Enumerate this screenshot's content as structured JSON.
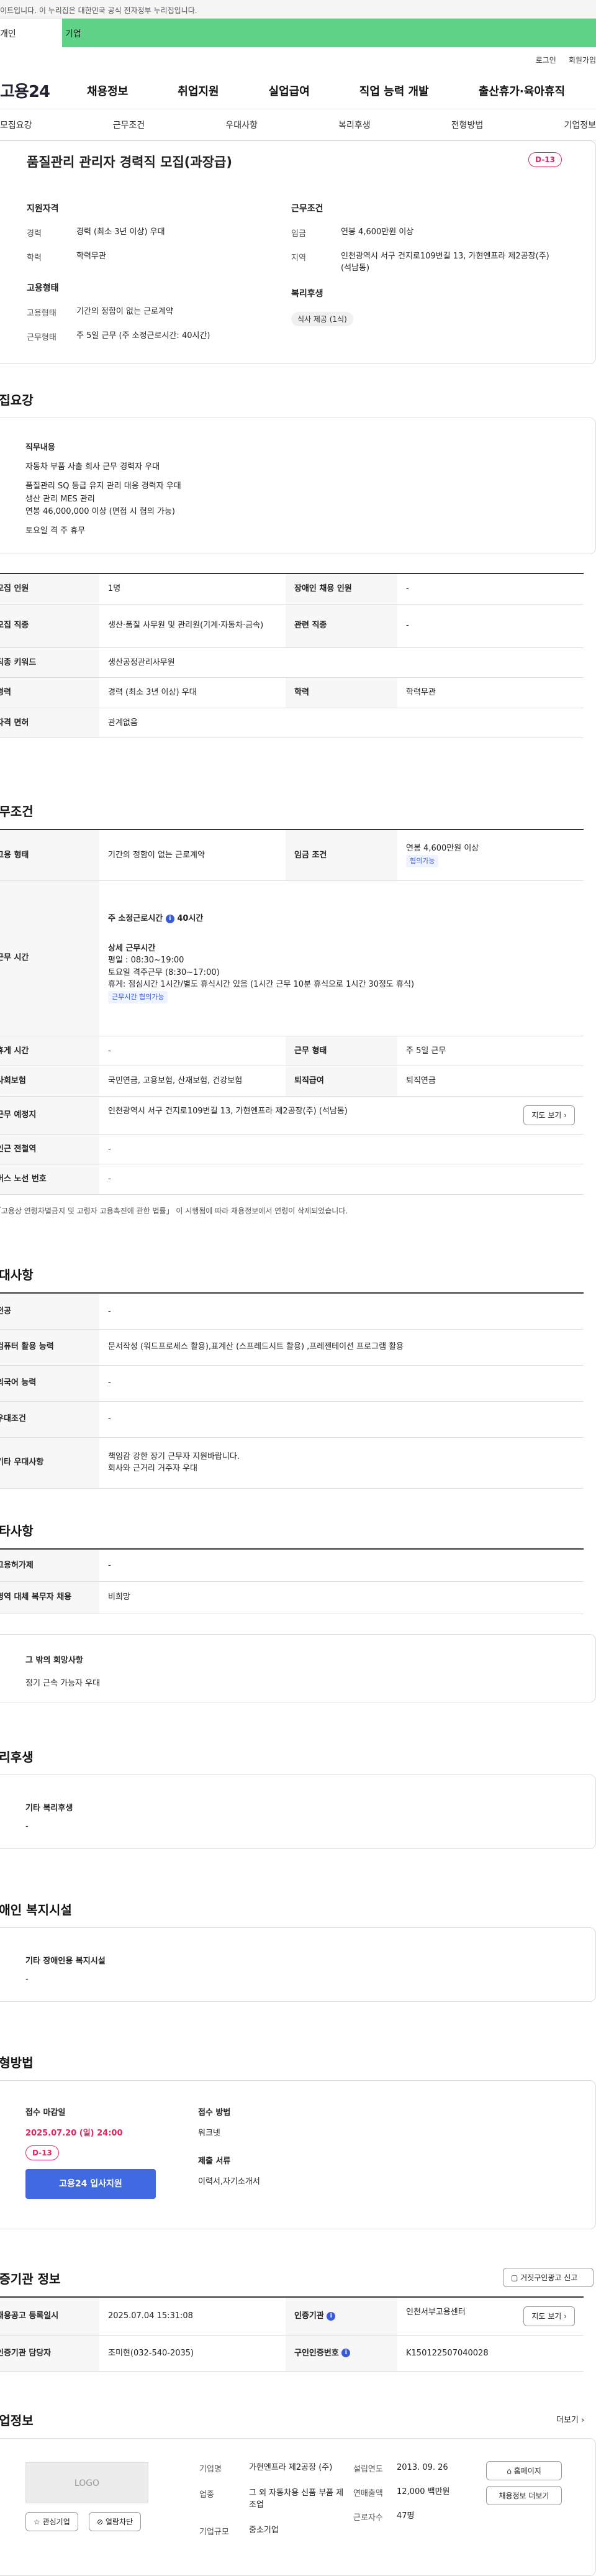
{
  "gov_banner": "이트입니다. 이 누리집은 대한민국 공식 전자정부 누리집입니다.",
  "top_tabs": [
    "개인",
    "기업"
  ],
  "util_links": [
    "로그인",
    "회원가입"
  ],
  "logo": "고용24",
  "gnb": [
    "채용정보",
    "취업지원",
    "실업급여",
    "직업 능력 개발",
    "출산휴가·육아휴직"
  ],
  "anchor_tabs": [
    "모집요강",
    "근무조건",
    "우대사항",
    "복리후생",
    "전형방법",
    "기업정보"
  ],
  "summary": {
    "title": "품질관리 관리자 경력직 모집(과장급)",
    "dday": "D-13",
    "left_title": "지원자격",
    "left_rows": [
      [
        "경력",
        "경력 (최소 3년 이상) 우대"
      ],
      [
        "학력",
        "학력무관"
      ]
    ],
    "right_title": "근무조건",
    "right_rows": [
      [
        "임금",
        "연봉 4,600만원 이상"
      ],
      [
        "지역",
        "인천광역시 서구 건지로109번길 13, 가현엔프라 제2공장(주) (석남동)"
      ]
    ],
    "left2_title": "고용형태",
    "left2_rows": [
      [
        "고용형태",
        "기간의 정함이 없는 근로계약"
      ],
      [
        "근무형태",
        "주 5일 근무 (주 소정근로시간: 40시간)"
      ]
    ],
    "right2_title": "복리후생",
    "right2_chip": "식사 제공 (1식)"
  },
  "recruit": {
    "title": "모집요강",
    "duty_title": "직무내용",
    "duty_lines": [
      "자동차 부품 사출 회사  근무 경력자 우대",
      "",
      "품질관리 SQ 등급 유지 관리 대응 경력자 우대",
      "생산 관리 MES 관리",
      "연봉 46,000,000 이상 (면접 시 협의 가능)",
      "",
      "토요일 격 주 휴무"
    ],
    "rows": [
      [
        "모집 인원",
        "1명",
        "장애인 채용 인원",
        "-"
      ],
      [
        "모집 직종",
        "생산·품질 사무원 및 관리원(기계·자동차·금속)",
        "관련 직종",
        "-"
      ],
      [
        "직종 키워드",
        "생산공정관리사무원",
        "",
        ""
      ],
      [
        "경력",
        "경력 (최소 3년 이상) 우대",
        "학력",
        "학력무관"
      ],
      [
        "자격 면허",
        "관계없음",
        "",
        ""
      ]
    ]
  },
  "work": {
    "title": "근무조건",
    "employ_label": "고용 형태",
    "employ_value": "기간의 정함이 없는 근로계약",
    "wage_label": "임금 조건",
    "wage_value": "연봉 4,600만원 이상",
    "wage_tag": "협의가능",
    "hours_label": "근무 시간",
    "hours_head": "주 소정근로시간",
    "hours_head_value": "40시간",
    "hours_detail_title": "상세 근무시간",
    "hours_lines": [
      "평일 : 08:30~19:00",
      "토요일 격주근무 (8:30~17:00)",
      "휴게: 점심시간 1시간/별도 휴식시간 있음 (1시간 근무 10분 휴식으로 1시간 30정도 휴식)"
    ],
    "hours_tag": "근무시간 협의가능",
    "rows": [
      [
        "휴게 시간",
        "-",
        "근무 형태",
        "주 5일 근무"
      ],
      [
        "사회보험",
        "국민연금, 고용보험, 산재보험, 건강보험",
        "퇴직급여",
        "퇴직연금"
      ]
    ],
    "place_label": "근무 예정지",
    "place_value": "인천광역시 서구 건지로109번길 13, 가현엔프라 제2공장(주) (석남동)",
    "map_btn": "지도 보기",
    "subway_label": "인근 전철역",
    "subway_value": "-",
    "bus_label": "버스 노선 번호",
    "bus_value": "-",
    "notice": "* 「고용상 연령차별금지 및 고령자 고용촉진에 관한 법률」 이 시행됨에 따라 채용정보에서 연령이 삭제되었습니다."
  },
  "pref": {
    "title": "우대사항",
    "rows": [
      [
        "전공",
        "-"
      ],
      [
        "컴퓨터 활용 능력",
        "문서작성 (워드프로세스 활용),표계산 (스프레드시트 활용) ,프레젠테이션 프로그램 활용"
      ],
      [
        "외국어 능력",
        "-"
      ],
      [
        "우대조건",
        "-"
      ],
      [
        "기타 우대사항",
        "책임감 강한 장기 근무자 지원바랍니다.\n회사와 근거리 거주자 우대"
      ]
    ]
  },
  "etc": {
    "title": "기타사항",
    "rows": [
      [
        "고용허가제",
        "-"
      ],
      [
        "병역 대체 복무자 채용",
        "비희망"
      ]
    ],
    "other_title": "그 밖의 희망사항",
    "other_value": "정기 근속 가능자 우대"
  },
  "welfare": {
    "title": "복리후생",
    "sub": "기타 복리후생",
    "value": "-"
  },
  "disabled": {
    "title": "장애인 복지시설",
    "sub": "기타 장애인용 복지시설",
    "value": "-"
  },
  "process": {
    "title": "전형방법",
    "deadline_label": "접수 마감일",
    "deadline": "2025.07.20 (일) 24:00",
    "dday": "D-13",
    "apply_btn": "고용24 입사지원",
    "method_label": "접수 방법",
    "method": "워크넷",
    "docs_label": "제출 서류",
    "docs": "이력서,자기소개서"
  },
  "cert": {
    "title": "인증기관 정보",
    "report_btn": "거짓구인광고 신고",
    "rows": [
      [
        "채용공고 등록일시",
        "2025.07.04 15:31:08",
        "인증기관",
        "인천서부고용센터"
      ],
      [
        "인증기관 담당자",
        "조미현(032-540-2035)",
        "구인인증번호",
        "K150122507040028"
      ]
    ],
    "map_btn": "지도 보기"
  },
  "company": {
    "title": "기업정보",
    "more": "더보기",
    "logo": "LOGO",
    "fav_btn": "관심기업",
    "block_btn": "열람차단",
    "name_label": "기업명",
    "name": "가현엔프라 제2공장 (주)",
    "industry_label": "업종",
    "industry": "그 외 자동차용 신품 부품 제조업",
    "size_label": "기업규모",
    "size": "중소기업",
    "founded_label": "설립연도",
    "founded": "2013. 09. 26",
    "sales_label": "연매출액",
    "sales": "12,000 백만원",
    "emp_label": "근로자수",
    "emp": "47명",
    "home_btn": "홈페이지",
    "jobs_btn": "채용정보 더보기"
  }
}
